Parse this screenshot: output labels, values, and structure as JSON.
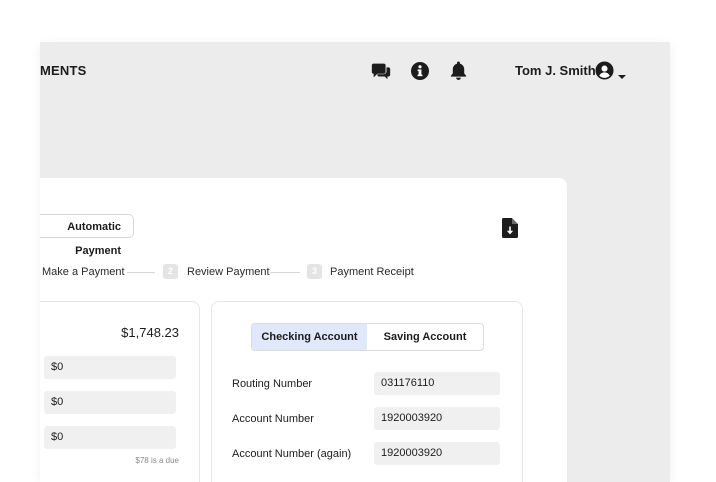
{
  "header": {
    "title": "MENTS",
    "user_name": "Tom J. Smith",
    "icons": [
      "chat-icon",
      "info-icon",
      "bell-icon",
      "user-avatar-icon",
      "caret-down-icon"
    ]
  },
  "card": {
    "automatic_payment_label": "Automatic Payment",
    "download_icon": "document-download-icon",
    "steps": [
      {
        "label": "Make a Payment"
      },
      {
        "num": "2",
        "label": "Review Payment"
      },
      {
        "num": "3",
        "label": "Payment Receipt"
      }
    ],
    "left_panel": {
      "balance": "$1,748.23",
      "fields": [
        "$0",
        "$0",
        "$0"
      ],
      "due_note": "$78 is a due"
    },
    "right_panel": {
      "tabs": [
        "Checking Account",
        "Saving Account"
      ],
      "active_tab": "Checking Account",
      "rows": [
        {
          "label": "Routing Number",
          "value": "031176110"
        },
        {
          "label": "Account Number",
          "value": "1920003920"
        },
        {
          "label": "Account Number (again)",
          "value": "1920003920"
        }
      ]
    }
  },
  "colors": {
    "app_background": "#ececec",
    "card_background": "#ffffff",
    "active_tab": "#e0e8fb",
    "field_background": "#f0f0f0",
    "text": "#1c1c1c"
  }
}
